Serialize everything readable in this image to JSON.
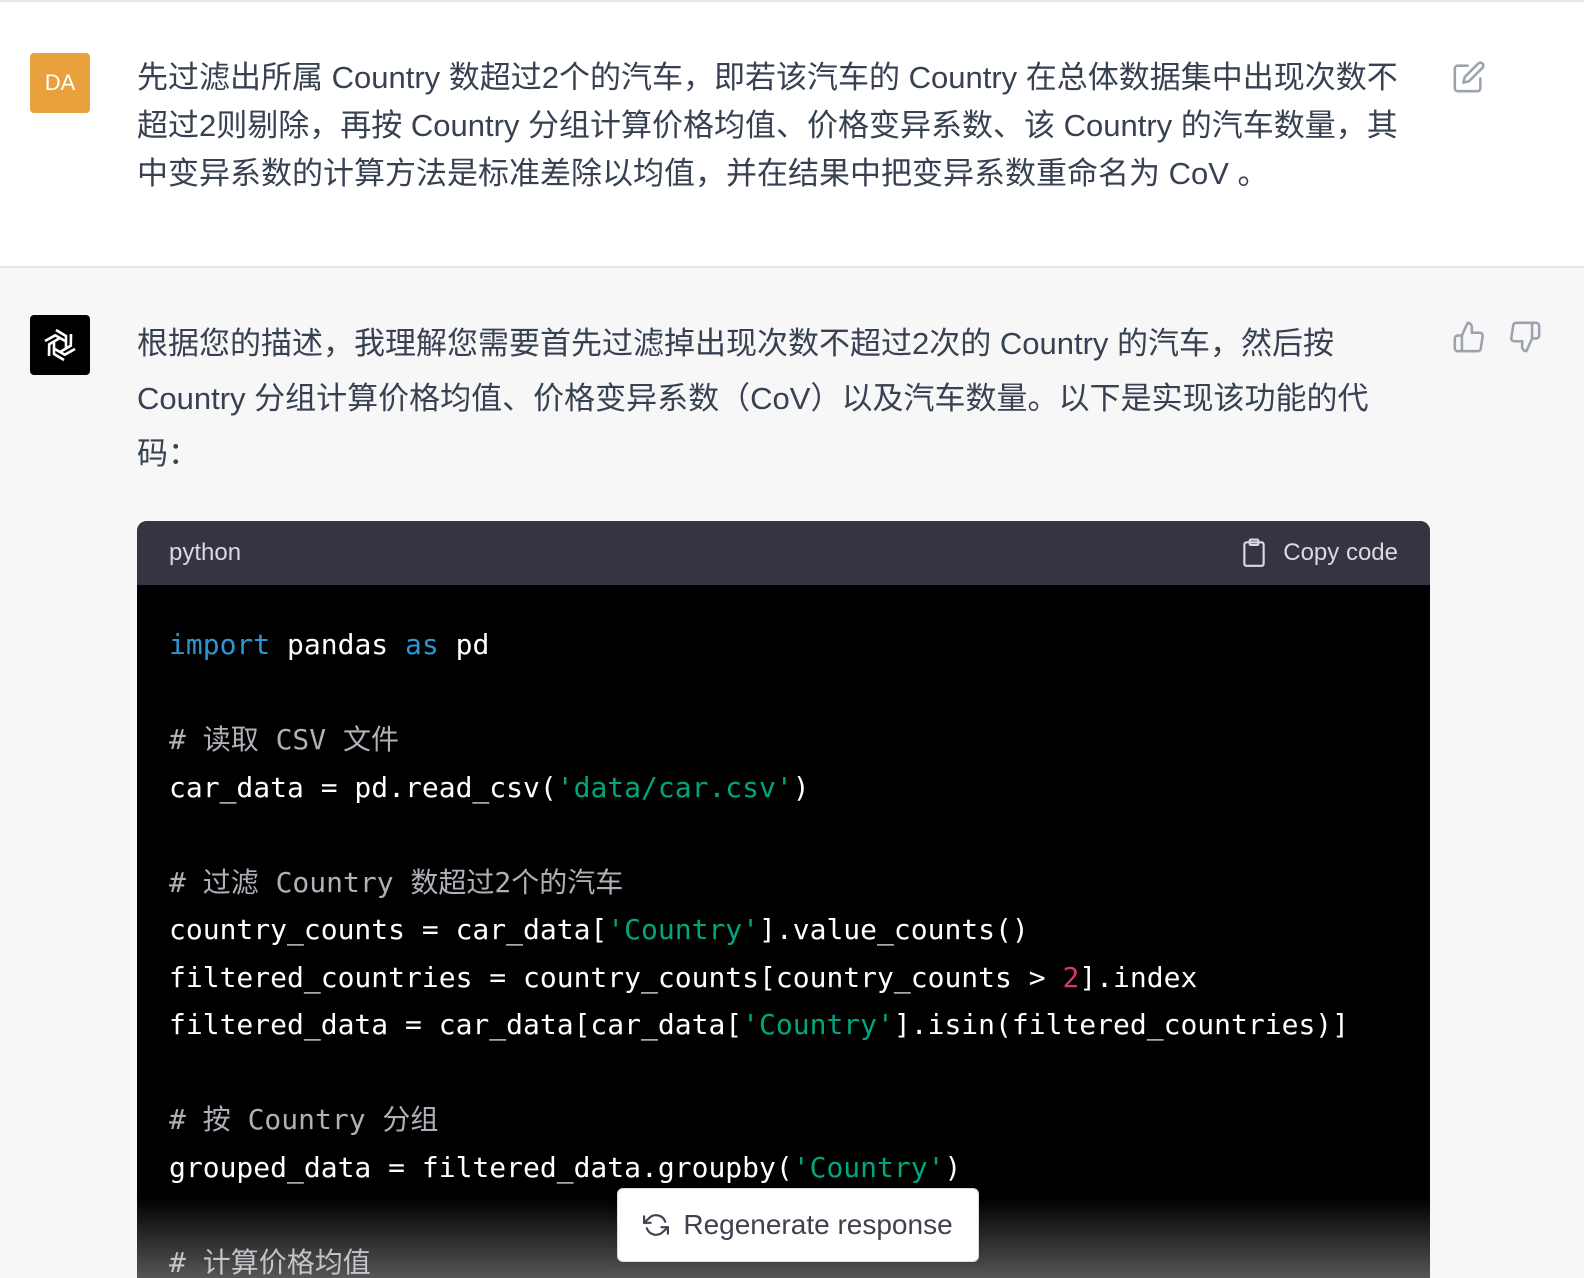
{
  "user_message": {
    "avatar_initials": "DA",
    "avatar_color": "#e8a13d",
    "text": "先过滤出所属 Country 数超过2个的汽车，即若该汽车的 Country 在总体数据集中出现次数不超过2则剔除，再按 Country 分组计算价格均值、价格变异系数、该 Country 的汽车数量，其中变异系数的计算方法是标准差除以均值，并在结果中把变异系数重命名为 CoV 。",
    "edit_icon": "edit-icon"
  },
  "assistant_message": {
    "avatar_icon": "openai-logo-icon",
    "intro_text": "根据您的描述，我理解您需要首先过滤掉出现次数不超过2次的 Country 的汽车，然后按 Country 分组计算价格均值、价格变异系数（CoV）以及汽车数量。以下是实现该功能的代码：",
    "feedback": {
      "thumb_up_icon": "thumb-up-icon",
      "thumb_down_icon": "thumb-down-icon"
    },
    "code_block": {
      "language": "python",
      "copy_label": "Copy code",
      "lines": [
        [
          {
            "t": "import",
            "c": "kw"
          },
          {
            "t": " pandas ",
            "c": ""
          },
          {
            "t": "as",
            "c": "kw"
          },
          {
            "t": " pd",
            "c": ""
          }
        ],
        [],
        [
          {
            "t": "# 读取 CSV 文件",
            "c": "cmt"
          }
        ],
        [
          {
            "t": "car_data = pd.read_csv(",
            "c": ""
          },
          {
            "t": "'data/car.csv'",
            "c": "str"
          },
          {
            "t": ")",
            "c": ""
          }
        ],
        [],
        [
          {
            "t": "# 过滤 Country 数超过2个的汽车",
            "c": "cmt"
          }
        ],
        [
          {
            "t": "country_counts = car_data[",
            "c": ""
          },
          {
            "t": "'Country'",
            "c": "str"
          },
          {
            "t": "].value_counts()",
            "c": ""
          }
        ],
        [
          {
            "t": "filtered_countries = country_counts[country_counts > ",
            "c": ""
          },
          {
            "t": "2",
            "c": "num"
          },
          {
            "t": "].index",
            "c": ""
          }
        ],
        [
          {
            "t": "filtered_data = car_data[car_data[",
            "c": ""
          },
          {
            "t": "'Country'",
            "c": "str"
          },
          {
            "t": "].isin(filtered_countries)]",
            "c": ""
          }
        ],
        [],
        [
          {
            "t": "# 按 Country 分组",
            "c": "cmt"
          }
        ],
        [
          {
            "t": "grouped_data = filtered_data.groupby(",
            "c": ""
          },
          {
            "t": "'Country'",
            "c": "str"
          },
          {
            "t": ")",
            "c": ""
          }
        ],
        [],
        [
          {
            "t": "# 计算价格均值",
            "c": "cmt"
          }
        ]
      ]
    }
  },
  "regenerate_button": {
    "label": "Regenerate response",
    "icon": "refresh-icon"
  }
}
